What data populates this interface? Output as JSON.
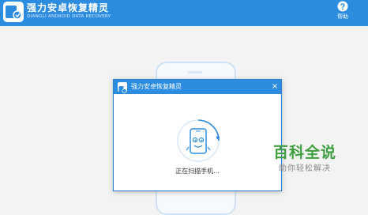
{
  "app": {
    "title": "强力安卓恢复精灵",
    "subtitle": "QIANGLI ANDROID DATA RECOVERY"
  },
  "header": {
    "help_label": "帮助",
    "help_icon": "question-circle-icon",
    "logo_icon": "app-logo-icon"
  },
  "dialog": {
    "title": "强力安卓恢复精灵",
    "close_symbol": "×",
    "status": "正在扫描手机...",
    "graphic_icon": "phone-scan-icon"
  },
  "watermark": {
    "main": "百科全说",
    "sub": "助你轻松解决"
  },
  "colors": {
    "accent": "#2c8de0",
    "background": "#f3f3f3",
    "watermark_green": "#3f9e3f"
  }
}
